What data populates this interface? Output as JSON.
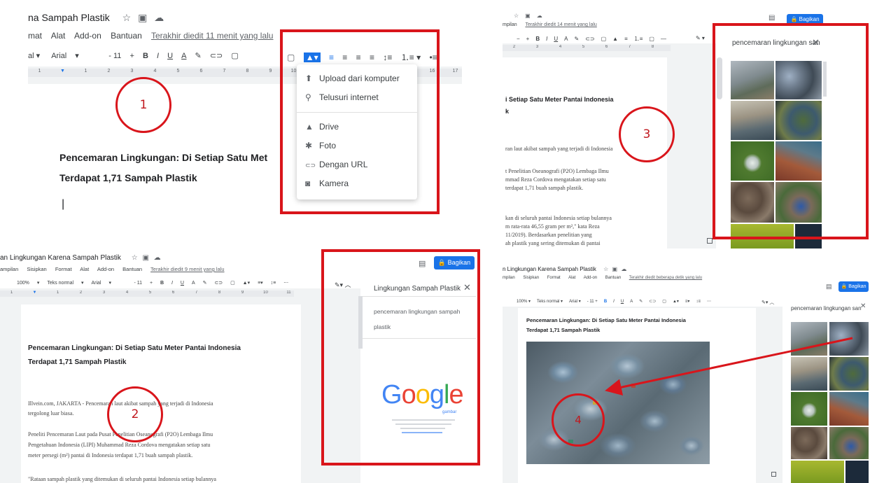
{
  "panel1": {
    "doc_title": "na Sampah Plastik",
    "menu": [
      "mat",
      "Alat",
      "Add-on",
      "Bantuan"
    ],
    "last_edit": "Terakhir diedit 11 menit yang lalu",
    "font_name": "Arial",
    "font_size": "11",
    "heading_line1": "Pencemaran Lingkungan: Di Setiap Satu Met",
    "heading_line2": "Terdapat 1,71 Sampah Plastik",
    "cursor": "|",
    "step_number": "1",
    "dropdown_items": [
      {
        "icon": "upload-icon",
        "glyph": "⬆",
        "label": "Upload dari komputer"
      },
      {
        "icon": "search-icon",
        "glyph": "⚲",
        "label": "Telusuri internet"
      },
      {
        "icon": "drive-icon",
        "glyph": "▲",
        "label": "Drive"
      },
      {
        "icon": "photos-icon",
        "glyph": "✱",
        "label": "Foto"
      },
      {
        "icon": "link-icon",
        "glyph": "⊂⊃",
        "label": "Dengan URL"
      },
      {
        "icon": "camera-icon",
        "glyph": "◙",
        "label": "Kamera"
      }
    ]
  },
  "panel2": {
    "doc_title": "an Lingkungan Karena Sampah Plastik",
    "menu": [
      "ampilan",
      "Sisipkan",
      "Format",
      "Alat",
      "Add-on",
      "Bantuan"
    ],
    "last_edit": "Terakhir diedit 9 menit yang lalu",
    "share_label": "Bagikan",
    "zoom": "100%",
    "style": "Teks normal",
    "font_name": "Arial",
    "font_size": "11",
    "heading_line1": "Pencemaran Lingkungan: Di Setiap Satu Meter Pantai Indonesia",
    "heading_line2": "Terdapat 1,71 Sampah Plastik",
    "body_lines": [
      "Illvein.com, JAKARTA - Pencemaran laut akibat sampah yang terjadi di Indonesia",
      "tergolong luar biasa.",
      "Peneliti Pencemaran Laut pada Pusat Penelitian Oseanografi (P2O) Lembaga Ilmu",
      "Pengetahuan Indonesia (LIPI) Muhammad Reza Cordova mengatakan setiap satu",
      "meter persegi (m²) pantai di Indonesia terdapat 1,71 buah sampah plastik.",
      "\"Rataan sampah plastik yang ditemukan di seluruh pantai Indonesia setiap bulannya"
    ],
    "side_search": "Lingkungan Sampah Plastik",
    "suggestions": [
      "pencemaran lingkungan sampah",
      "plastik"
    ],
    "google_logo": [
      "G",
      "o",
      "o",
      "g",
      "l",
      "e"
    ],
    "google_sub": "gambar",
    "step_number": "2"
  },
  "panel3": {
    "menu": [
      "mpilan"
    ],
    "last_edit": "Terakhir diedit 14 menit yang lalu",
    "share_label": "Bagikan",
    "side_search": "pencemaran lingkungan san",
    "heading_line1": "i Setiap Satu Meter Pantai Indonesia",
    "heading_line2": "k",
    "body_lines": [
      "ran laut akibat sampah yang terjadi di Indonesia",
      "t Penelitian Oseanografi (P2O) Lembaga Ilmu",
      "mmad Reza Cordova mengatakan setiap satu",
      "terdapat 1,71 buah sampah plastik.",
      "kan di seluruh pantai Indonesia setiap bulannya",
      "m rata-rata 46,55 gram per m²,\" kata Reza",
      "11/2019). Berdasarkan penelitian yang",
      "ah plastik yang sering ditemukan di pantai"
    ],
    "step_number": "3"
  },
  "panel4": {
    "doc_title": "n Lingkungan Karena Sampah Plastik",
    "menu": [
      "mpilan",
      "Sisipkan",
      "Format",
      "Alat",
      "Add-on",
      "Bantuan"
    ],
    "last_edit": "Terakhir diedit beberapa detik yang lalu",
    "share_label": "Bagikan",
    "side_search": "pencemaran lingkungan san",
    "heading_line1": "Pencemaran Lingkungan: Di Setiap Satu Meter Pantai Indonesia",
    "heading_line2": "Terdapat 1,71 Sampah Plastik",
    "step_number": "4"
  },
  "colors": {
    "red": "#d9151b",
    "blue": "#1a73e8",
    "g_blue": "#4285f4",
    "g_red": "#ea4335",
    "g_yellow": "#fbbc05",
    "g_green": "#34a853"
  }
}
